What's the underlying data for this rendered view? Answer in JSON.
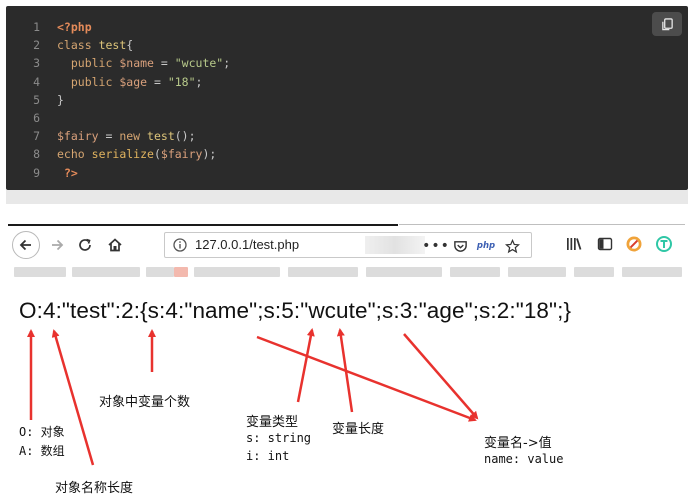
{
  "code": {
    "line_numbers": [
      "1",
      "2",
      "3",
      "4",
      "5",
      "6",
      "7",
      "8",
      "9"
    ],
    "line1": "<?php",
    "line2_kw": "class",
    "line2_cls": "test",
    "line2_rest": "{",
    "line3_kw": "public",
    "line3_var": "$name",
    "line3_eq": " = ",
    "line3_str": "\"wcute\"",
    "line3_end": ";",
    "line4_kw": "public",
    "line4_var": "$age",
    "line4_eq": " = ",
    "line4_str": "\"18\"",
    "line4_end": ";",
    "line5": "}",
    "line7_var": "$fairy",
    "line7_eq": " = ",
    "line7_kw": "new",
    "line7_cls": "test",
    "line7_end": "();",
    "line8_kw": "echo",
    "line8_fn": "serialize",
    "line8_open": "(",
    "line8_var": "$fairy",
    "line8_end": ");",
    "line9": "?>"
  },
  "browser": {
    "url": "127.0.0.1/test.php",
    "php_badge": "php",
    "menu_dots": "•••"
  },
  "page": {
    "serialized_output": "O:4:\"test\":2:{s:4:\"name\";s:5:\"wcute\";s:3:\"age\";s:2:\"18\";}"
  },
  "annotations": {
    "obj_prop_count": "对象中变量个数",
    "var_type_title": "变量类型",
    "var_type_s": "s: string",
    "var_type_i": "i: int",
    "var_length": "变量长度",
    "var_name_value": "变量名->值",
    "name_value": "name: value",
    "o_object": "O: 对象",
    "a_array": "A: 数组",
    "obj_name_length": "对象名称长度"
  },
  "colors": {
    "code_bg": "#2b2b2b",
    "arrow_red": "#e8322e",
    "url_text": "#222222"
  }
}
